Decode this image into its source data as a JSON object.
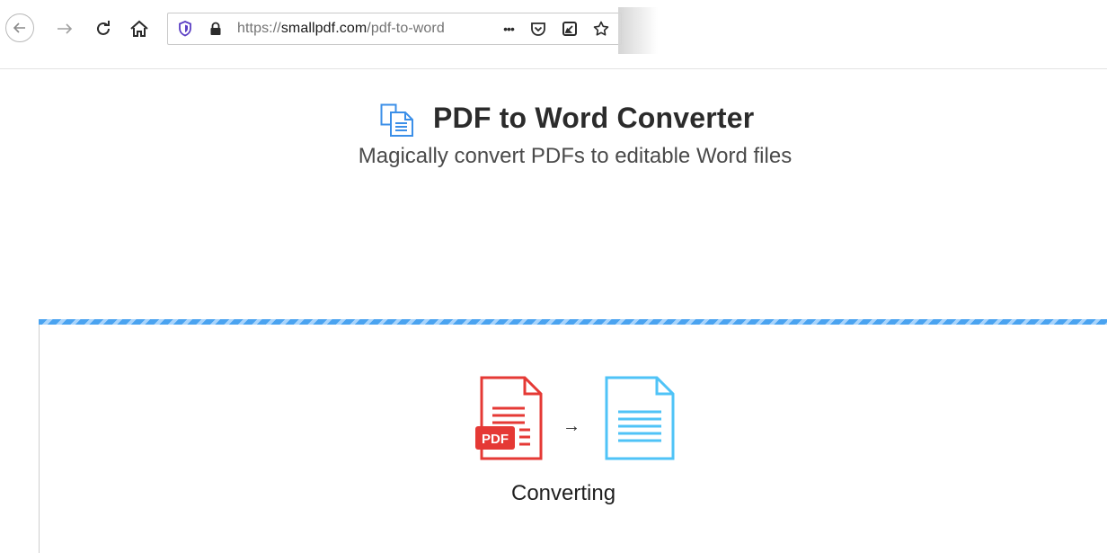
{
  "browser": {
    "url_scheme": "https://",
    "url_host": "smallpdf.com",
    "url_path": "/pdf-to-word",
    "icons": {
      "back": "arrow-left-icon",
      "forward": "arrow-right-icon",
      "reload": "reload-icon",
      "home": "home-icon",
      "tracking": "shield-icon",
      "lock": "lock-icon",
      "more": "more-dots-icon",
      "pocket": "pocket-icon",
      "extension": "edit-page-icon",
      "bookmark": "star-icon"
    },
    "more_label": "•••"
  },
  "page": {
    "title": "PDF to Word Converter",
    "subtitle": "Magically convert PDFs to editable Word files",
    "accent_color": "#3b8fe8"
  },
  "converter": {
    "source_badge": "PDF",
    "arrow": "→",
    "status": "Converting",
    "pdf_color": "#e53935",
    "doc_color": "#4fc3f7"
  }
}
